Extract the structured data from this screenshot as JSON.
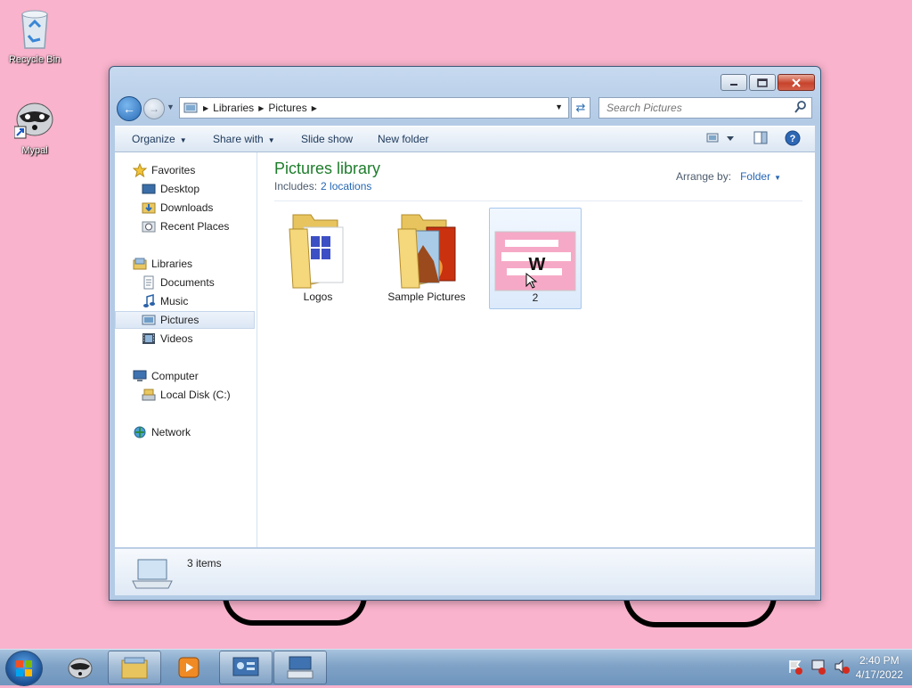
{
  "desktop": {
    "icons": [
      {
        "label": "Recycle Bin",
        "icon": "recycle-bin-icon"
      },
      {
        "label": "Mypal",
        "icon": "raccoon-icon"
      }
    ]
  },
  "window": {
    "address": {
      "crumbs": [
        "Libraries",
        "Pictures"
      ]
    },
    "search": {
      "placeholder": "Search Pictures"
    },
    "toolbar": {
      "organize": "Organize",
      "share_with": "Share with",
      "slide_show": "Slide show",
      "new_folder": "New folder"
    },
    "nav": {
      "favorites": {
        "label": "Favorites",
        "items": [
          "Desktop",
          "Downloads",
          "Recent Places"
        ]
      },
      "libraries": {
        "label": "Libraries",
        "items": [
          "Documents",
          "Music",
          "Pictures",
          "Videos"
        ],
        "selected": "Pictures"
      },
      "computer": {
        "label": "Computer",
        "items": [
          "Local Disk (C:)"
        ]
      },
      "network": {
        "label": "Network"
      }
    },
    "content": {
      "title": "Pictures library",
      "includes_label": "Includes:",
      "includes_link": "2 locations",
      "arrange_label": "Arrange by:",
      "arrange_value": "Folder",
      "items": [
        {
          "name": "Logos",
          "type": "folder"
        },
        {
          "name": "Sample Pictures",
          "type": "folder"
        },
        {
          "name": "2",
          "type": "image",
          "selected": true
        }
      ]
    },
    "status": {
      "count": "3 items"
    }
  },
  "taskbar": {
    "clock": {
      "time": "2:40 PM",
      "date": "4/17/2022"
    }
  },
  "colors": {
    "desktop": "#f9b3cc",
    "library_title": "#1e7d2c",
    "link": "#2567b4"
  }
}
